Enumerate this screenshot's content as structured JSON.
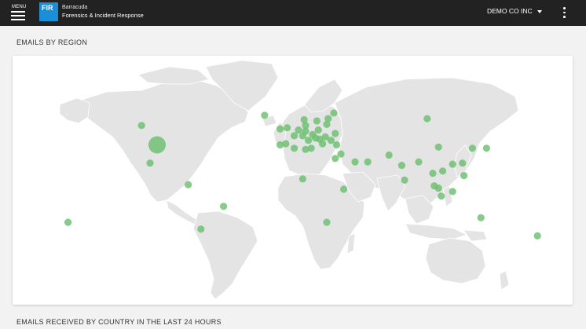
{
  "header": {
    "menu_label": "MENU",
    "logo_text": "FIR",
    "brand_company": "Barracuda",
    "brand_product": "Forensics & Incident Response",
    "org_name": "DEMO CO INC"
  },
  "sections": {
    "emails_by_region": "EMAILS BY REGION",
    "emails_by_country": "EMAILS RECEIVED BY COUNTRY IN THE LAST 24 HOURS"
  },
  "colors": {
    "topbar": "#222222",
    "logo": "#1a8ed8",
    "bubble": "#6cc070",
    "land": "#e4e4e4"
  },
  "map": {
    "bubbles": [
      {
        "lon": -95,
        "lat": 39,
        "size": "large"
      },
      {
        "lon": -106,
        "lat": 56,
        "size": "small"
      },
      {
        "lon": -100,
        "lat": 23,
        "size": "small"
      },
      {
        "lon": -73,
        "lat": 4,
        "size": "small"
      },
      {
        "lon": -48,
        "lat": -15,
        "size": "small"
      },
      {
        "lon": -64,
        "lat": -35,
        "size": "small"
      },
      {
        "lon": -158,
        "lat": -29,
        "size": "small"
      },
      {
        "lon": -19,
        "lat": 65,
        "size": "small"
      },
      {
        "lon": -3,
        "lat": 54,
        "size": "small"
      },
      {
        "lon": -8,
        "lat": 53,
        "size": "small"
      },
      {
        "lon": 2,
        "lat": 47,
        "size": "small"
      },
      {
        "lon": -4,
        "lat": 40,
        "size": "small"
      },
      {
        "lon": -8,
        "lat": 39,
        "size": "small"
      },
      {
        "lon": 5,
        "lat": 52,
        "size": "small"
      },
      {
        "lon": 10,
        "lat": 51,
        "size": "small"
      },
      {
        "lon": 8,
        "lat": 47,
        "size": "small"
      },
      {
        "lon": 12,
        "lat": 43,
        "size": "small"
      },
      {
        "lon": 15,
        "lat": 48,
        "size": "small"
      },
      {
        "lon": 19,
        "lat": 52,
        "size": "small"
      },
      {
        "lon": 10,
        "lat": 56,
        "size": "small"
      },
      {
        "lon": 9,
        "lat": 61,
        "size": "small"
      },
      {
        "lon": 18,
        "lat": 60,
        "size": "small"
      },
      {
        "lon": 26,
        "lat": 62,
        "size": "small"
      },
      {
        "lon": 25,
        "lat": 57,
        "size": "small"
      },
      {
        "lon": 24,
        "lat": 46,
        "size": "small"
      },
      {
        "lon": 22,
        "lat": 40,
        "size": "small"
      },
      {
        "lon": 28,
        "lat": 43,
        "size": "small"
      },
      {
        "lon": 32,
        "lat": 39,
        "size": "small"
      },
      {
        "lon": 20,
        "lat": 44,
        "size": "small"
      },
      {
        "lon": 17,
        "lat": 45,
        "size": "small"
      },
      {
        "lon": 31,
        "lat": 49,
        "size": "small"
      },
      {
        "lon": 30,
        "lat": 67,
        "size": "small"
      },
      {
        "lon": 14,
        "lat": 36,
        "size": "small"
      },
      {
        "lon": 2,
        "lat": 36,
        "size": "small"
      },
      {
        "lon": 10,
        "lat": 35,
        "size": "small"
      },
      {
        "lon": 31,
        "lat": 27,
        "size": "small"
      },
      {
        "lon": 35,
        "lat": 31,
        "size": "small"
      },
      {
        "lon": 45,
        "lat": 24,
        "size": "small"
      },
      {
        "lon": 54,
        "lat": 24,
        "size": "small"
      },
      {
        "lon": 69,
        "lat": 30,
        "size": "small"
      },
      {
        "lon": 78,
        "lat": 21,
        "size": "small"
      },
      {
        "lon": 90,
        "lat": 24,
        "size": "small"
      },
      {
        "lon": 37,
        "lat": 0,
        "size": "small"
      },
      {
        "lon": 8,
        "lat": 9,
        "size": "small"
      },
      {
        "lon": 25,
        "lat": -29,
        "size": "small"
      },
      {
        "lon": 80,
        "lat": 8,
        "size": "small"
      },
      {
        "lon": 100,
        "lat": 14,
        "size": "small"
      },
      {
        "lon": 101,
        "lat": 3,
        "size": "small"
      },
      {
        "lon": 104,
        "lat": 1,
        "size": "small"
      },
      {
        "lon": 107,
        "lat": 16,
        "size": "small"
      },
      {
        "lon": 114,
        "lat": 22,
        "size": "small"
      },
      {
        "lon": 121,
        "lat": 23,
        "size": "small"
      },
      {
        "lon": 122,
        "lat": 12,
        "size": "small"
      },
      {
        "lon": 106,
        "lat": -6,
        "size": "small"
      },
      {
        "lon": 114,
        "lat": -2,
        "size": "small"
      },
      {
        "lon": 104,
        "lat": 37,
        "size": "small"
      },
      {
        "lon": 128,
        "lat": 36,
        "size": "small"
      },
      {
        "lon": 138,
        "lat": 36,
        "size": "small"
      },
      {
        "lon": 96,
        "lat": 62,
        "size": "small"
      },
      {
        "lon": 134,
        "lat": -25,
        "size": "small"
      },
      {
        "lon": 174,
        "lat": -41,
        "size": "small"
      }
    ]
  }
}
